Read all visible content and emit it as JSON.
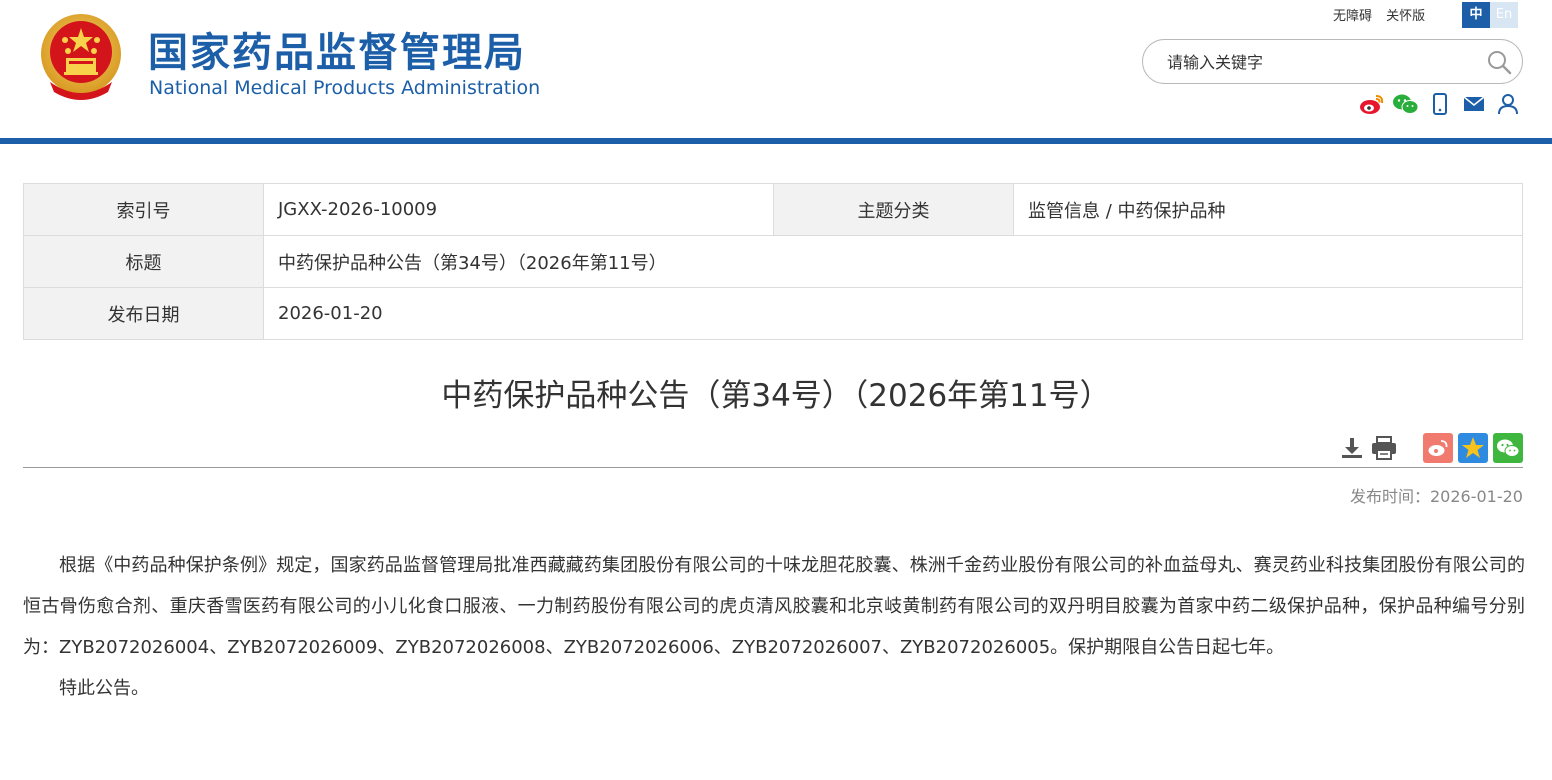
{
  "header": {
    "title_cn": "国家药品监督管理局",
    "title_en": "National Medical Products Administration",
    "links": {
      "accessibility": "无障碍",
      "elderly": "关怀版"
    },
    "lang": {
      "zh": "中",
      "en": "En"
    },
    "search": {
      "placeholder": "请输入关键字"
    },
    "brand_color": "#1c5fa8"
  },
  "info": {
    "index_label": "索引号",
    "index_value": "JGXX-2026-10009",
    "topic_label": "主题分类",
    "topic_value": "监管信息 / 中药保护品种",
    "title_label": "标题",
    "title_value": "中药保护品种公告（第34号）（2026年第11号）",
    "date_label": "发布日期",
    "date_value": "2026-01-20"
  },
  "article": {
    "title": "中药保护品种公告（第34号）（2026年第11号）",
    "pubtime": "发布时间：2026-01-20",
    "paragraphs": [
      "根据《中药品种保护条例》规定，国家药品监督管理局批准西藏藏药集团股份有限公司的十味龙胆花胶囊、株洲千金药业股份有限公司的补血益母丸、赛灵药业科技集团股份有限公司的恒古骨伤愈合剂、重庆香雪医药有限公司的小儿化食口服液、一力制药股份有限公司的虎贞清风胶囊和北京岐黄制药有限公司的双丹明目胶囊为首家中药二级保护品种，保护品种编号分别为：ZYB2072026004、ZYB2072026009、ZYB2072026008、ZYB2072026006、ZYB2072026007、ZYB2072026005。保护期限自公告日起七年。",
      "特此公告。"
    ]
  },
  "icons": {
    "header_social": [
      "weibo-icon",
      "wechat-icon",
      "mobile-icon",
      "mail-icon",
      "user-icon"
    ],
    "article_tools": [
      "download-icon",
      "print-icon"
    ],
    "article_share": [
      "weibo-share-icon",
      "qzone-share-icon",
      "wechat-share-icon"
    ]
  }
}
